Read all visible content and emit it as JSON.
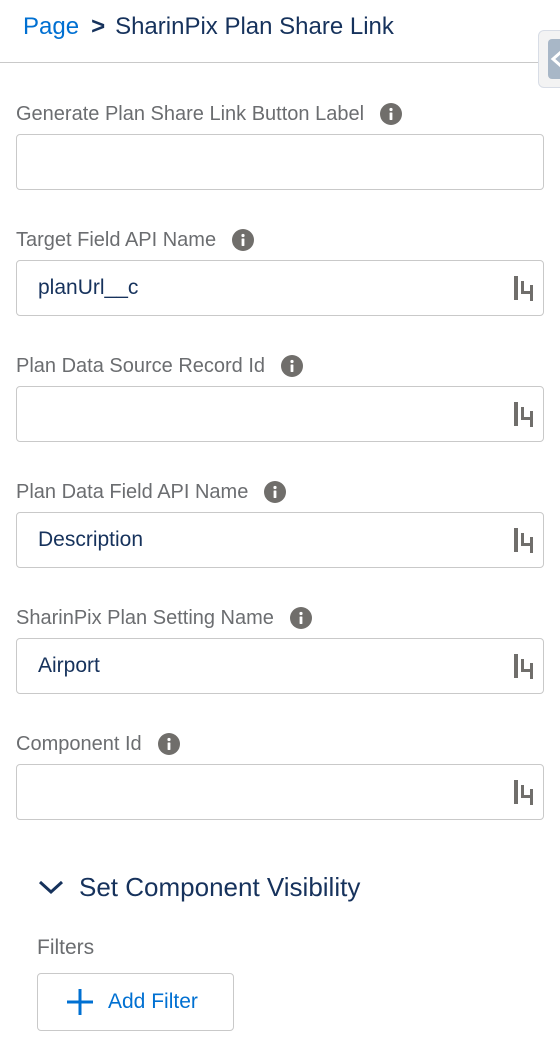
{
  "breadcrumb": {
    "root": "Page",
    "separator": ">",
    "current": "SharinPix Plan Share Link"
  },
  "fields": [
    {
      "label": "Generate Plan Share Link Button Label",
      "value": "",
      "has_merge_icon": false
    },
    {
      "label": "Target Field API Name",
      "value": "planUrl__c",
      "has_merge_icon": true
    },
    {
      "label": "Plan Data Source Record Id",
      "value": "",
      "has_merge_icon": true
    },
    {
      "label": "Plan Data Field API Name",
      "value": "Description",
      "has_merge_icon": true
    },
    {
      "label": "SharinPix Plan Setting Name",
      "value": "Airport",
      "has_merge_icon": true
    },
    {
      "label": "Component Id",
      "value": "",
      "has_merge_icon": true
    }
  ],
  "visibility_section": {
    "title": "Set Component Visibility",
    "expanded": true,
    "filters_label": "Filters",
    "add_filter_label": "Add Filter"
  },
  "icons": {
    "info": "info-icon",
    "merge": "merge-field-icon",
    "chevron": "chevron-down-icon",
    "add": "plus-icon",
    "side_tab": "chevron-left-icon"
  },
  "colors": {
    "link": "#0070d2",
    "heading": "#16325c",
    "label": "#6b6d70",
    "border": "#c9c9c9",
    "info_icon": "#706e6b"
  }
}
